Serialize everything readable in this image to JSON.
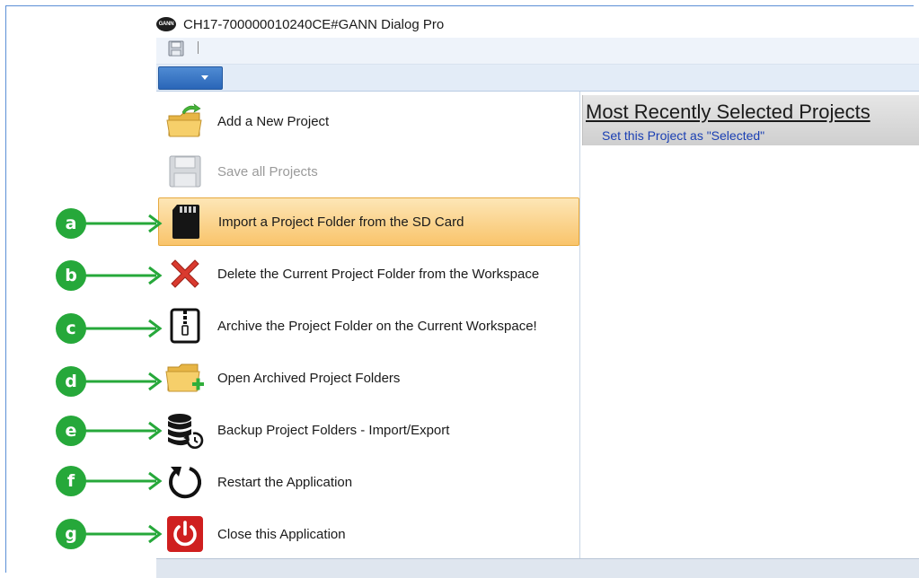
{
  "window": {
    "title": "CH17-700000010240CE#GANN Dialog Pro",
    "logo_text": "GANN"
  },
  "menu": {
    "items": [
      {
        "label": "Add a New Project",
        "icon": "add-folder-icon",
        "state": "normal"
      },
      {
        "label": "Save all Projects",
        "icon": "floppy-disk-icon",
        "state": "disabled"
      },
      {
        "label": "Import a Project Folder from the SD Card",
        "icon": "sd-card-icon",
        "state": "selected"
      },
      {
        "label": "Delete the Current Project Folder from the Workspace",
        "icon": "red-x-icon",
        "state": "normal"
      },
      {
        "label": "Archive the Project Folder on the Current Workspace!",
        "icon": "zip-archive-icon",
        "state": "normal"
      },
      {
        "label": "Open Archived Project Folders",
        "icon": "folder-plus-icon",
        "state": "normal"
      },
      {
        "label": "Backup Project Folders - Import/Export",
        "icon": "database-restore-icon",
        "state": "normal"
      },
      {
        "label": "Restart the Application",
        "icon": "restart-icon",
        "state": "normal"
      },
      {
        "label": "Close this Application",
        "icon": "power-icon",
        "state": "normal"
      }
    ]
  },
  "recent": {
    "title": "Most Recently Selected Projects",
    "set_selected_link": "Set this Project as \"Selected\""
  },
  "callouts": [
    "a",
    "b",
    "c",
    "d",
    "e",
    "f",
    "g"
  ],
  "colors": {
    "selected_gradient_top": "#fde6b6",
    "selected_gradient_bottom": "#f9c46b",
    "callout_green": "#26a83a",
    "link_blue": "#1a3fb3",
    "file_tab_blue": "#2a66b8"
  }
}
